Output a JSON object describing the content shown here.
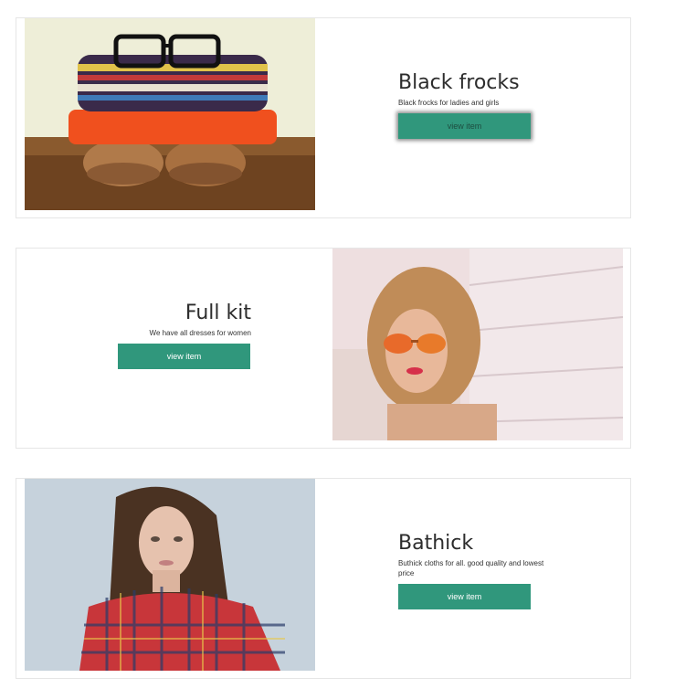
{
  "products": [
    {
      "title": "Black frocks",
      "description": "Black frocks for ladies and girls",
      "button_label": "view item"
    },
    {
      "title": "Full kit",
      "description": "We have all dresses for women",
      "button_label": "view item"
    },
    {
      "title": "Bathick",
      "description": "Buthick cloths for all. good quality and lowest price",
      "button_label": "view item"
    }
  ],
  "colors": {
    "button": "#30977c",
    "card_border": "#e6e6e6",
    "title_text": "#2c2c2c"
  }
}
